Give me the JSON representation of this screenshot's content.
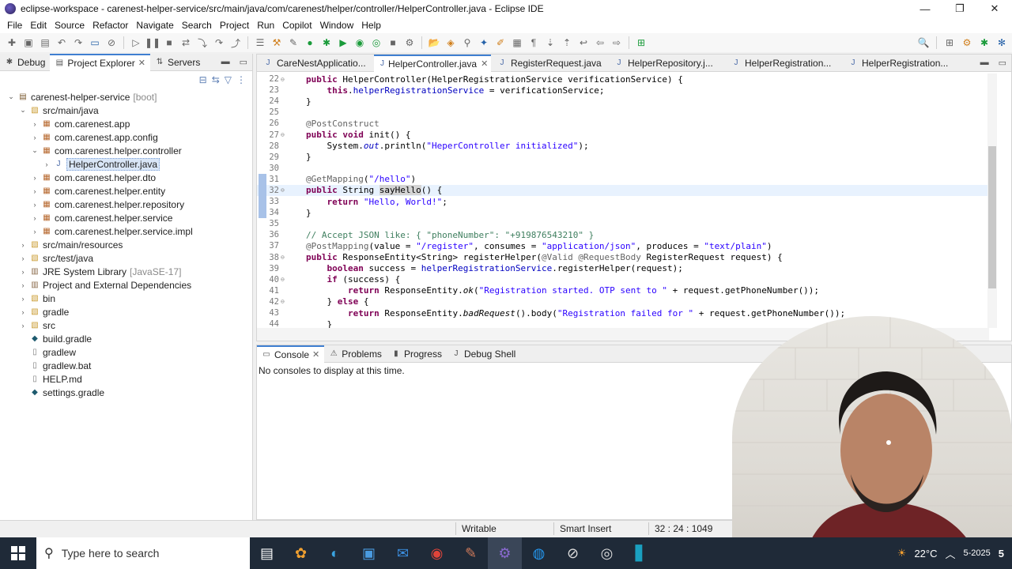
{
  "window": {
    "title": "eclipse-workspace - carenest-helper-service/src/main/java/com/carenest/helper/controller/HelperController.java - Eclipse IDE",
    "controls": [
      "—",
      "❐",
      "✕"
    ]
  },
  "menu": [
    "File",
    "Edit",
    "Source",
    "Refactor",
    "Navigate",
    "Search",
    "Project",
    "Run",
    "Copilot",
    "Window",
    "Help"
  ],
  "left_tabs": [
    {
      "label": "Debug"
    },
    {
      "label": "Project Explorer"
    },
    {
      "label": "Servers"
    }
  ],
  "tree": [
    {
      "label": "carenest-helper-service",
      "suffix": "[boot]",
      "depth": 0,
      "twist": "⌄",
      "icon": "project"
    },
    {
      "label": "src/main/java",
      "depth": 1,
      "twist": "⌄",
      "icon": "folder"
    },
    {
      "label": "com.carenest.app",
      "depth": 2,
      "twist": "›",
      "icon": "pkg"
    },
    {
      "label": "com.carenest.app.config",
      "depth": 2,
      "twist": "›",
      "icon": "pkg"
    },
    {
      "label": "com.carenest.helper.controller",
      "depth": 2,
      "twist": "⌄",
      "icon": "pkg"
    },
    {
      "label": "HelperController.java",
      "depth": 3,
      "twist": "›",
      "icon": "java",
      "selected": true
    },
    {
      "label": "com.carenest.helper.dto",
      "depth": 2,
      "twist": "›",
      "icon": "pkg"
    },
    {
      "label": "com.carenest.helper.entity",
      "depth": 2,
      "twist": "›",
      "icon": "pkg"
    },
    {
      "label": "com.carenest.helper.repository",
      "depth": 2,
      "twist": "›",
      "icon": "pkg"
    },
    {
      "label": "com.carenest.helper.service",
      "depth": 2,
      "twist": "›",
      "icon": "pkg"
    },
    {
      "label": "com.carenest.helper.service.impl",
      "depth": 2,
      "twist": "›",
      "icon": "pkg"
    },
    {
      "label": "src/main/resources",
      "depth": 1,
      "twist": "›",
      "icon": "folder"
    },
    {
      "label": "src/test/java",
      "depth": 1,
      "twist": "›",
      "icon": "folder"
    },
    {
      "label": "JRE System Library",
      "suffix": "[JavaSE-17]",
      "depth": 1,
      "twist": "›",
      "icon": "lib"
    },
    {
      "label": "Project and External Dependencies",
      "depth": 1,
      "twist": "›",
      "icon": "lib"
    },
    {
      "label": "bin",
      "depth": 1,
      "twist": "›",
      "icon": "folder"
    },
    {
      "label": "gradle",
      "depth": 1,
      "twist": "›",
      "icon": "folder"
    },
    {
      "label": "src",
      "depth": 1,
      "twist": "›",
      "icon": "folder"
    },
    {
      "label": "build.gradle",
      "depth": 1,
      "twist": "",
      "icon": "gradle"
    },
    {
      "label": "gradlew",
      "depth": 1,
      "twist": "",
      "icon": "file"
    },
    {
      "label": "gradlew.bat",
      "depth": 1,
      "twist": "",
      "icon": "file"
    },
    {
      "label": "HELP.md",
      "depth": 1,
      "twist": "",
      "icon": "file"
    },
    {
      "label": "settings.gradle",
      "depth": 1,
      "twist": "",
      "icon": "gradle"
    }
  ],
  "editor_tabs": [
    {
      "label": "CareNestApplicatio..."
    },
    {
      "label": "HelperController.java",
      "active": true
    },
    {
      "label": "RegisterRequest.java"
    },
    {
      "label": "HelperRepository.j..."
    },
    {
      "label": "HelperRegistration..."
    },
    {
      "label": "HelperRegistration..."
    }
  ],
  "code": [
    {
      "n": "22",
      "fold": "⊖",
      "t": "public HelperController(HelperRegistrationService verificationService) {"
    },
    {
      "n": "23",
      "t": "    this.helperRegistrationService = verificationService;"
    },
    {
      "n": "24",
      "t": "}"
    },
    {
      "n": "25",
      "t": ""
    },
    {
      "n": "26",
      "t": "@PostConstruct"
    },
    {
      "n": "27",
      "fold": "⊖",
      "t": "public void init() {"
    },
    {
      "n": "28",
      "t": "    System.out.println(\"HeperController initialized\");"
    },
    {
      "n": "29",
      "t": "}"
    },
    {
      "n": "30",
      "t": ""
    },
    {
      "n": "31",
      "t": "@GetMapping(\"/hello\")"
    },
    {
      "n": "32",
      "fold": "⊖",
      "t": "public String sayHello() {",
      "current": true
    },
    {
      "n": "33",
      "t": "    return \"Hello, World!\";"
    },
    {
      "n": "34",
      "t": "}"
    },
    {
      "n": "35",
      "t": ""
    },
    {
      "n": "36",
      "t": "// Accept JSON like: { \"phoneNumber\": \"+919876543210\" }"
    },
    {
      "n": "37",
      "t": "@PostMapping(value = \"/register\", consumes = \"application/json\", produces = \"text/plain\")"
    },
    {
      "n": "38",
      "fold": "⊖",
      "t": "public ResponseEntity<String> registerHelper(@Valid @RequestBody RegisterRequest request) {"
    },
    {
      "n": "39",
      "t": "    boolean success = helperRegistrationService.registerHelper(request);"
    },
    {
      "n": "40",
      "fold": "⊖",
      "t": "    if (success) {"
    },
    {
      "n": "41",
      "t": "        return ResponseEntity.ok(\"Registration started. OTP sent to \" + request.getPhoneNumber());"
    },
    {
      "n": "42",
      "fold": "⊖",
      "t": "    } else {"
    },
    {
      "n": "43",
      "t": "        return ResponseEntity.badRequest().body(\"Registration failed for \" + request.getPhoneNumber());"
    },
    {
      "n": "44",
      "t": "    }"
    }
  ],
  "console_tabs": [
    {
      "label": "Console"
    },
    {
      "label": "Problems"
    },
    {
      "label": "Progress"
    },
    {
      "label": "Debug Shell"
    }
  ],
  "console_message": "No consoles to display at this time.",
  "status": {
    "writable": "Writable",
    "insert_mode": "Smart Insert",
    "position": "32 : 24 : 1049"
  },
  "taskbar": {
    "search_placeholder": "Type here to search",
    "weather": "22°C",
    "date_fragment": "5-2025",
    "notification_count": "5"
  },
  "colors": {
    "accent": "#3f7fd1",
    "keyword": "#7f0055",
    "string": "#2a00ff",
    "comment": "#3f7f5f",
    "taskbar": "#1f2a38"
  }
}
